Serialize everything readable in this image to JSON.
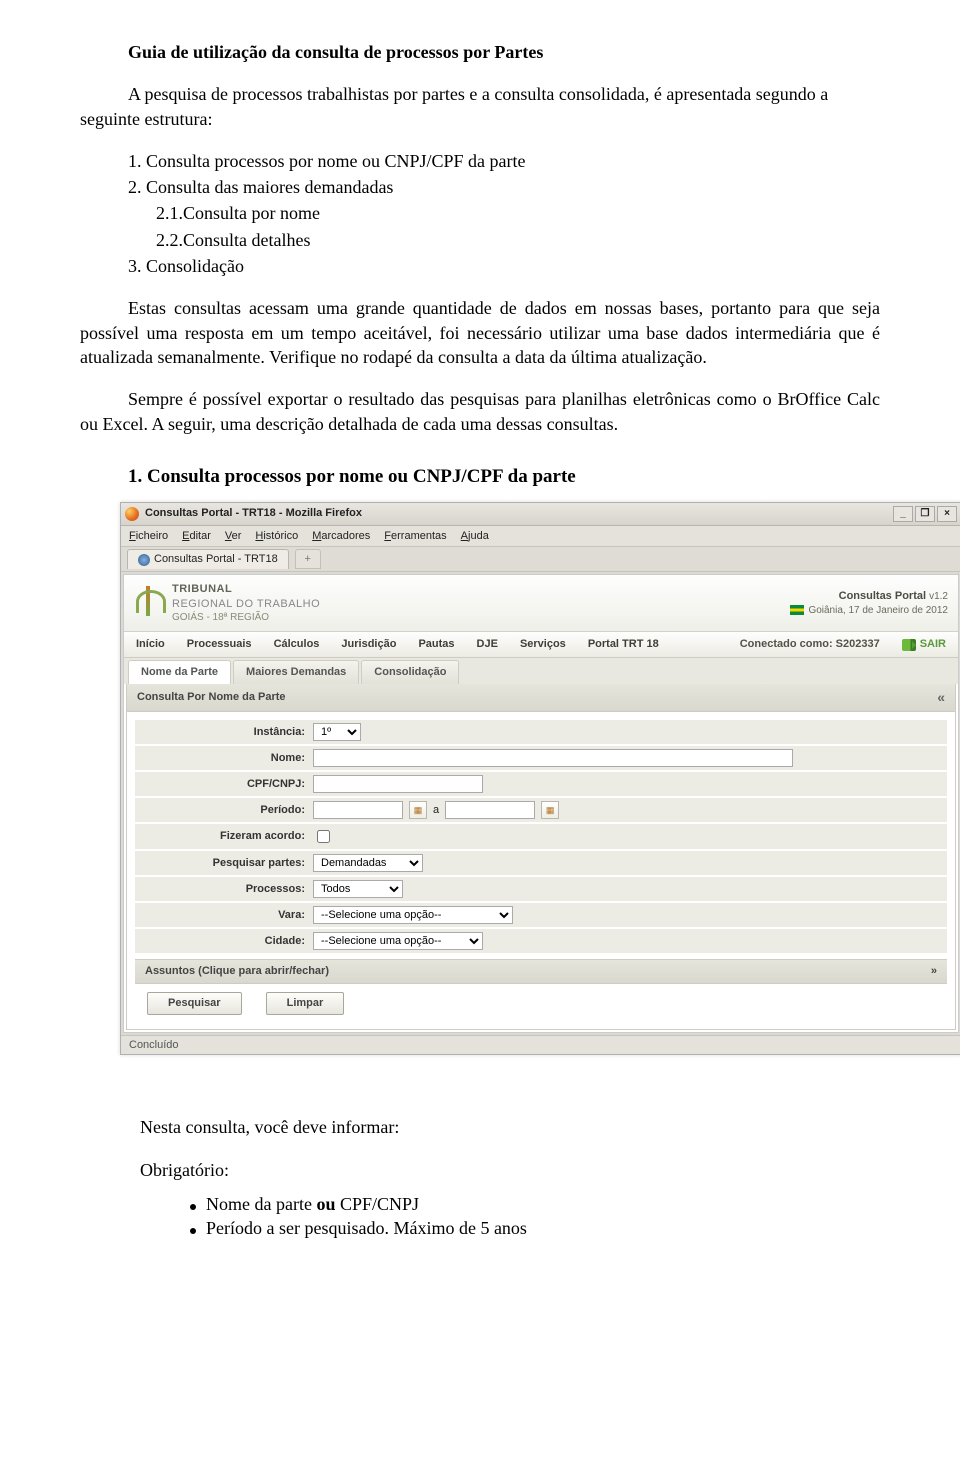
{
  "doc": {
    "title": "Guia de utilização da consulta de processos por Partes",
    "intro": "A pesquisa de processos trabalhistas por partes e a consulta consolidada, é apresentada segundo a seguinte estrutura:",
    "outline": [
      "1. Consulta processos por nome ou CNPJ/CPF da parte",
      "2. Consulta das maiores demandadas",
      "2.1.Consulta por nome",
      "2.2.Consulta detalhes",
      "3. Consolidação"
    ],
    "p1": "Estas consultas acessam uma grande quantidade de dados em nossas bases, portanto para que seja possível uma resposta em um tempo aceitável, foi necessário utilizar uma base dados intermediária que é atualizada semanalmente. Verifique no rodapé da consulta a data da última atualização.",
    "p2a": "Sempre é possível exportar o resultado das pesquisas para planilhas eletrônicas como o BrOffice Calc ou  Excel. A seguir, uma descrição detalhada de cada uma dessas consultas.",
    "h1": "1. Consulta processos por nome ou CNPJ/CPF da parte",
    "footer_lead": "Nesta consulta, você deve informar:",
    "footer_oblig": "Obrigatório:",
    "bullet1a": "Nome da parte ",
    "bullet1b": "ou",
    "bullet1c": " CPF/CNPJ",
    "bullet2": "Período a ser pesquisado. Máximo de 5 anos"
  },
  "win": {
    "title": "Consultas Portal - TRT18 - Mozilla Firefox",
    "min": "_",
    "restore": "❐",
    "close": "×",
    "menu": [
      "Ficheiro",
      "Editar",
      "Ver",
      "Histórico",
      "Marcadores",
      "Ferramentas",
      "Ajuda"
    ],
    "tab_label": "Consultas Portal - TRT18",
    "plus": "+"
  },
  "portal": {
    "org1": "TRIBUNAL",
    "org2": "REGIONAL DO TRABALHO",
    "sub": "GOIÁS - 18ª REGIÃO",
    "name": "Consultas Portal",
    "ver": "v1.2",
    "date": "Goiânia, 17 de Janeiro de 2012",
    "nav": [
      "Início",
      "Processuais",
      "Cálculos",
      "Jurisdição",
      "Pautas",
      "DJE",
      "Serviços",
      "Portal TRT 18"
    ],
    "conn_label": "Conectado como: ",
    "conn_user": "S202337",
    "sair": "SAIR",
    "tabs": [
      "Nome da Parte",
      "Maiores Demandas",
      "Consolidação"
    ],
    "panel_title": "Consulta Por Nome da Parte",
    "collapse": "«",
    "expand": "»",
    "fields": {
      "instancia_label": "Instância:",
      "instancia_value": "1º",
      "nome_label": "Nome:",
      "cpf_label": "CPF/CNPJ:",
      "periodo_label": "Período:",
      "periodo_sep": "a",
      "acordo_label": "Fizeram acordo:",
      "partes_label": "Pesquisar partes:",
      "partes_value": "Demandadas",
      "proc_label": "Processos:",
      "proc_value": "Todos",
      "vara_label": "Vara:",
      "vara_value": "--Selecione uma opção--",
      "cidade_label": "Cidade:",
      "cidade_value": "--Selecione uma opção--"
    },
    "assuntos_label": "Assuntos (Clique para abrir/fechar)",
    "btn_search": "Pesquisar",
    "btn_clear": "Limpar",
    "status": "Concluído"
  }
}
